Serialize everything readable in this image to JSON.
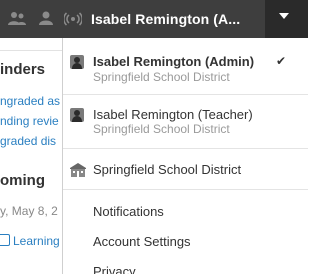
{
  "topbar": {
    "user_name": "Isabel Remington (A...",
    "icons": [
      "people-icon",
      "user-icon",
      "broadcast-icon",
      "chevron-down-icon"
    ]
  },
  "background_page": {
    "section1_heading": "inders",
    "links": [
      "ngraded as",
      "nding revie",
      "graded dis"
    ],
    "section2_heading": "oming",
    "date_text": "y, May 8, 2",
    "event_link": "Learning"
  },
  "menu": {
    "profiles": [
      {
        "name": "Isabel Remington (Admin)",
        "org": "Springfield School District",
        "selected": true,
        "check": "✔"
      },
      {
        "name": "Isabel Remington (Teacher)",
        "org": "Springfield School District",
        "selected": false
      }
    ],
    "organization": "Springfield School District",
    "links": [
      "Notifications",
      "Account Settings",
      "Privacy"
    ]
  },
  "colors": {
    "topbar_bg": "#3e3e3e",
    "link": "#2a7fc1",
    "muted": "#9a9a9a"
  }
}
